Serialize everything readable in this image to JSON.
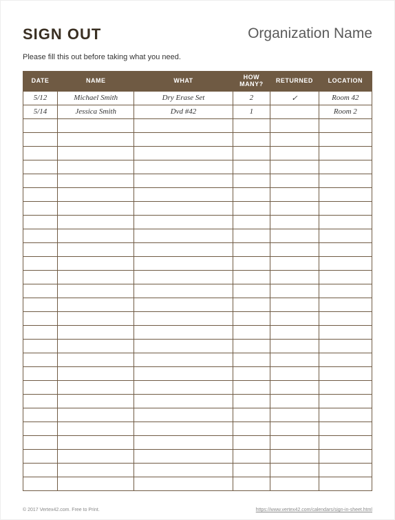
{
  "header": {
    "title": "SIGN OUT",
    "organization": "Organization Name",
    "instruction": "Please fill this out before taking what you need."
  },
  "table": {
    "columns": [
      "DATE",
      "NAME",
      "WHAT",
      "HOW MANY?",
      "RETURNED",
      "LOCATION"
    ],
    "rows": [
      {
        "date": "5/12",
        "name": "Michael Smith",
        "what": "Dry Erase Set",
        "how_many": "2",
        "returned": "✓",
        "location": "Room 42"
      },
      {
        "date": "5/14",
        "name": "Jessica Smith",
        "what": "Dvd #42",
        "how_many": "1",
        "returned": "",
        "location": "Room 2"
      }
    ],
    "empty_rows": 27
  },
  "footer": {
    "left": "© 2017 Vertex42.com. Free to Print.",
    "right": "https://www.vertex42.com/calendars/sign-in-sheet.html"
  }
}
